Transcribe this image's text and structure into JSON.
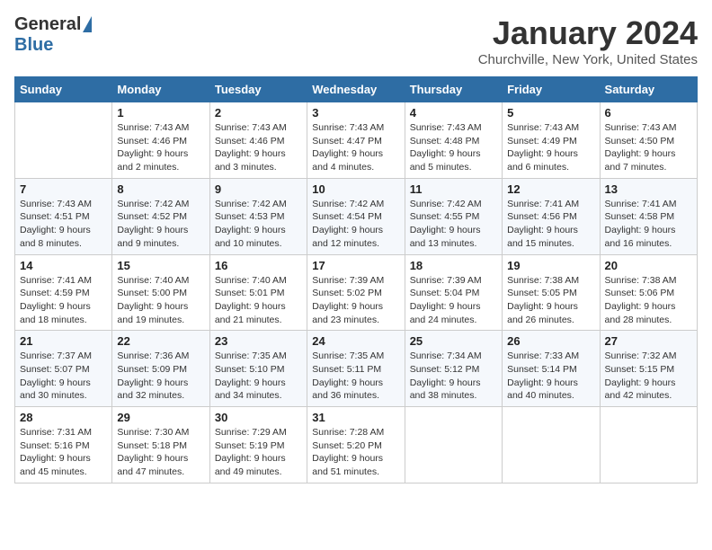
{
  "header": {
    "logo_general": "General",
    "logo_blue": "Blue",
    "title": "January 2024",
    "location": "Churchville, New York, United States"
  },
  "days_of_week": [
    "Sunday",
    "Monday",
    "Tuesday",
    "Wednesday",
    "Thursday",
    "Friday",
    "Saturday"
  ],
  "weeks": [
    [
      {
        "day": "",
        "info": ""
      },
      {
        "day": "1",
        "info": "Sunrise: 7:43 AM\nSunset: 4:46 PM\nDaylight: 9 hours\nand 2 minutes."
      },
      {
        "day": "2",
        "info": "Sunrise: 7:43 AM\nSunset: 4:46 PM\nDaylight: 9 hours\nand 3 minutes."
      },
      {
        "day": "3",
        "info": "Sunrise: 7:43 AM\nSunset: 4:47 PM\nDaylight: 9 hours\nand 4 minutes."
      },
      {
        "day": "4",
        "info": "Sunrise: 7:43 AM\nSunset: 4:48 PM\nDaylight: 9 hours\nand 5 minutes."
      },
      {
        "day": "5",
        "info": "Sunrise: 7:43 AM\nSunset: 4:49 PM\nDaylight: 9 hours\nand 6 minutes."
      },
      {
        "day": "6",
        "info": "Sunrise: 7:43 AM\nSunset: 4:50 PM\nDaylight: 9 hours\nand 7 minutes."
      }
    ],
    [
      {
        "day": "7",
        "info": "Sunrise: 7:43 AM\nSunset: 4:51 PM\nDaylight: 9 hours\nand 8 minutes."
      },
      {
        "day": "8",
        "info": "Sunrise: 7:42 AM\nSunset: 4:52 PM\nDaylight: 9 hours\nand 9 minutes."
      },
      {
        "day": "9",
        "info": "Sunrise: 7:42 AM\nSunset: 4:53 PM\nDaylight: 9 hours\nand 10 minutes."
      },
      {
        "day": "10",
        "info": "Sunrise: 7:42 AM\nSunset: 4:54 PM\nDaylight: 9 hours\nand 12 minutes."
      },
      {
        "day": "11",
        "info": "Sunrise: 7:42 AM\nSunset: 4:55 PM\nDaylight: 9 hours\nand 13 minutes."
      },
      {
        "day": "12",
        "info": "Sunrise: 7:41 AM\nSunset: 4:56 PM\nDaylight: 9 hours\nand 15 minutes."
      },
      {
        "day": "13",
        "info": "Sunrise: 7:41 AM\nSunset: 4:58 PM\nDaylight: 9 hours\nand 16 minutes."
      }
    ],
    [
      {
        "day": "14",
        "info": "Sunrise: 7:41 AM\nSunset: 4:59 PM\nDaylight: 9 hours\nand 18 minutes."
      },
      {
        "day": "15",
        "info": "Sunrise: 7:40 AM\nSunset: 5:00 PM\nDaylight: 9 hours\nand 19 minutes."
      },
      {
        "day": "16",
        "info": "Sunrise: 7:40 AM\nSunset: 5:01 PM\nDaylight: 9 hours\nand 21 minutes."
      },
      {
        "day": "17",
        "info": "Sunrise: 7:39 AM\nSunset: 5:02 PM\nDaylight: 9 hours\nand 23 minutes."
      },
      {
        "day": "18",
        "info": "Sunrise: 7:39 AM\nSunset: 5:04 PM\nDaylight: 9 hours\nand 24 minutes."
      },
      {
        "day": "19",
        "info": "Sunrise: 7:38 AM\nSunset: 5:05 PM\nDaylight: 9 hours\nand 26 minutes."
      },
      {
        "day": "20",
        "info": "Sunrise: 7:38 AM\nSunset: 5:06 PM\nDaylight: 9 hours\nand 28 minutes."
      }
    ],
    [
      {
        "day": "21",
        "info": "Sunrise: 7:37 AM\nSunset: 5:07 PM\nDaylight: 9 hours\nand 30 minutes."
      },
      {
        "day": "22",
        "info": "Sunrise: 7:36 AM\nSunset: 5:09 PM\nDaylight: 9 hours\nand 32 minutes."
      },
      {
        "day": "23",
        "info": "Sunrise: 7:35 AM\nSunset: 5:10 PM\nDaylight: 9 hours\nand 34 minutes."
      },
      {
        "day": "24",
        "info": "Sunrise: 7:35 AM\nSunset: 5:11 PM\nDaylight: 9 hours\nand 36 minutes."
      },
      {
        "day": "25",
        "info": "Sunrise: 7:34 AM\nSunset: 5:12 PM\nDaylight: 9 hours\nand 38 minutes."
      },
      {
        "day": "26",
        "info": "Sunrise: 7:33 AM\nSunset: 5:14 PM\nDaylight: 9 hours\nand 40 minutes."
      },
      {
        "day": "27",
        "info": "Sunrise: 7:32 AM\nSunset: 5:15 PM\nDaylight: 9 hours\nand 42 minutes."
      }
    ],
    [
      {
        "day": "28",
        "info": "Sunrise: 7:31 AM\nSunset: 5:16 PM\nDaylight: 9 hours\nand 45 minutes."
      },
      {
        "day": "29",
        "info": "Sunrise: 7:30 AM\nSunset: 5:18 PM\nDaylight: 9 hours\nand 47 minutes."
      },
      {
        "day": "30",
        "info": "Sunrise: 7:29 AM\nSunset: 5:19 PM\nDaylight: 9 hours\nand 49 minutes."
      },
      {
        "day": "31",
        "info": "Sunrise: 7:28 AM\nSunset: 5:20 PM\nDaylight: 9 hours\nand 51 minutes."
      },
      {
        "day": "",
        "info": ""
      },
      {
        "day": "",
        "info": ""
      },
      {
        "day": "",
        "info": ""
      }
    ]
  ]
}
